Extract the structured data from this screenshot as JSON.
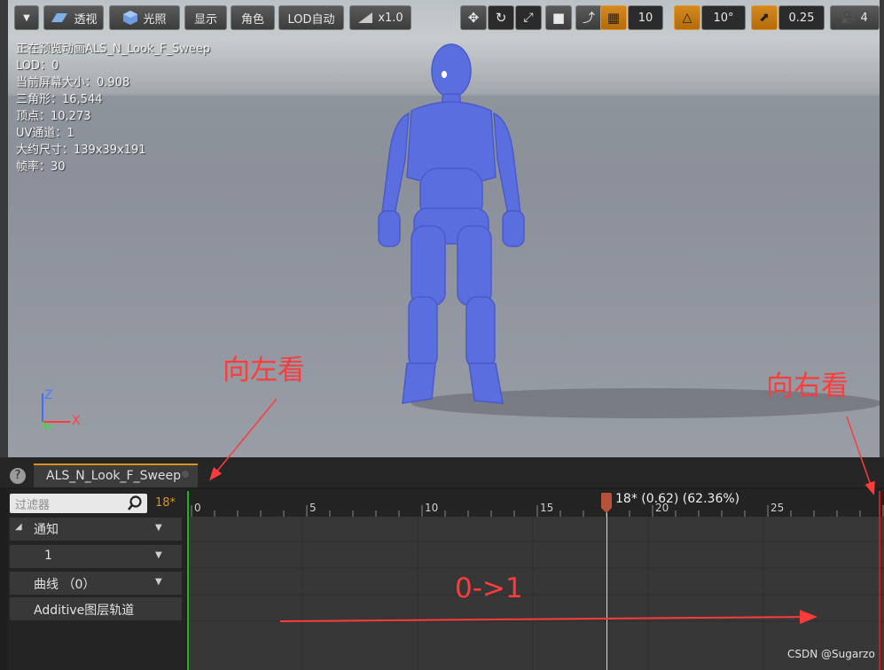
{
  "toolbar": {
    "perspective": "透视",
    "lighting": "光照",
    "show": "显示",
    "character": "角色",
    "lod": "LOD自动",
    "speed": "x1.0",
    "grid_snap": "10",
    "rotation_snap": "10°",
    "scale_snap": "0.25",
    "camera_speed": "4"
  },
  "info": {
    "preview": "正在预览动画ALS_N_Look_F_Sweep",
    "lod": "LOD：0",
    "screen_size": "当前屏幕大小：0.908",
    "triangles": "三角形：16,544",
    "vertices": "顶点：10,273",
    "uv_channels": "UV通道：1",
    "approx_size": "大约尺寸：139x39x191",
    "frame_rate": "帧率：30"
  },
  "axis": {
    "z": "Z",
    "x": "X",
    "y": "Y"
  },
  "annotations": {
    "look_left": "向左看",
    "look_right": "向右看",
    "range": "0->1"
  },
  "tab": {
    "label": "ALS_N_Look_F_Sweep"
  },
  "tracks": {
    "filter_placeholder": "过滤器",
    "frame_badge": "18*",
    "notify": "通知",
    "notify_item": "1",
    "curves": "曲线 （0）",
    "additive": "Additive图层轨道"
  },
  "timeline": {
    "ticks": [
      "0",
      "5",
      "10",
      "15",
      "20",
      "25"
    ],
    "current_frame_label": "18* (0.62) (62.36%)",
    "current_frame": 18,
    "total_frames": 30
  },
  "watermark": "CSDN @Sugarzo",
  "colors": {
    "accent": "#d9901f",
    "annotation": "#ff3b3b",
    "character": "#5b6ee0"
  }
}
